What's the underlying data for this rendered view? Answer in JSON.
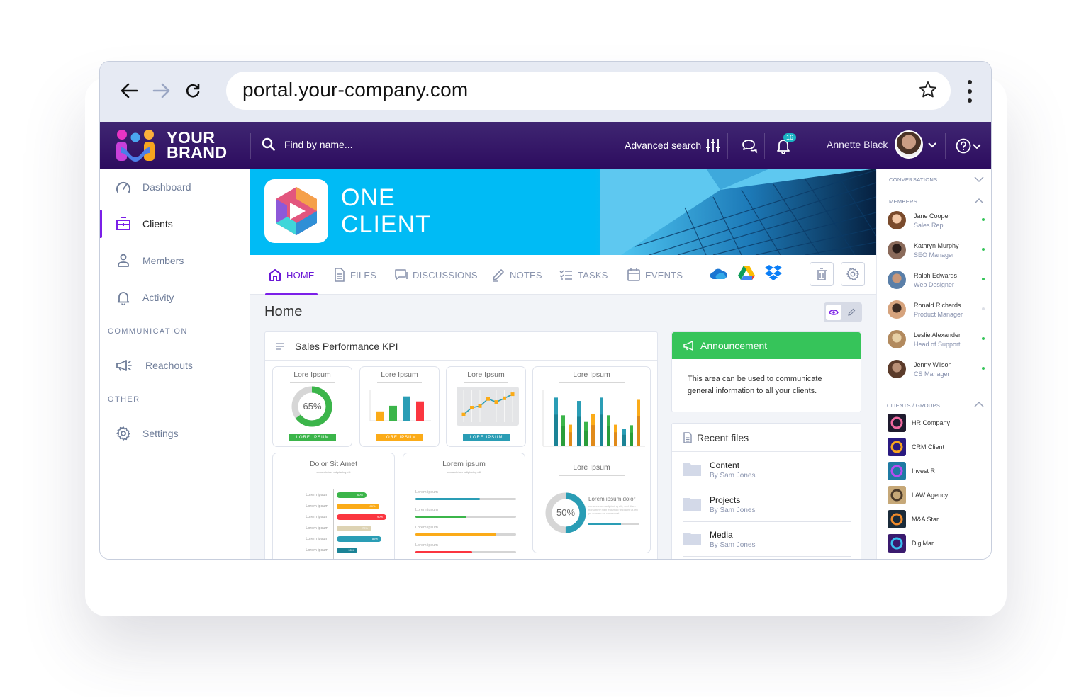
{
  "browser": {
    "url": "portal.your-company.com",
    "back_icon": "arrow-left-icon",
    "forward_icon": "arrow-right-icon",
    "reload_icon": "reload-icon",
    "bookmark_icon": "star-icon",
    "menu_icon": "kebab-menu-icon"
  },
  "header": {
    "brand_line1": "YOUR",
    "brand_line2": "BRAND",
    "search_placeholder": "Find by name...",
    "advanced_search": "Advanced search",
    "notifications_count": "16",
    "user_name": "Annette Black",
    "colors": {
      "header_top": "#3f2672",
      "header_bottom": "#2d0c5f",
      "badge": "#1ab4c3"
    }
  },
  "sidebar": {
    "items": [
      {
        "label": "Dashboard",
        "icon": "speedometer-icon"
      },
      {
        "label": "Clients",
        "icon": "briefcase-icon",
        "active": true
      },
      {
        "label": "Members",
        "icon": "user-icon"
      },
      {
        "label": "Activity",
        "icon": "bell-icon"
      }
    ],
    "section_communication": "COMMUNICATION",
    "communication_items": [
      {
        "label": "Reachouts",
        "icon": "megaphone-icon"
      }
    ],
    "section_other": "OTHER",
    "other_items": [
      {
        "label": "Settings",
        "icon": "gear-icon"
      }
    ],
    "accent": "#7b1fe8"
  },
  "banner": {
    "title_line1": "ONE",
    "title_line2": "CLIENT",
    "color": "#00bbf5"
  },
  "tabs": [
    {
      "label": "HOME",
      "icon": "home-icon",
      "active": true
    },
    {
      "label": "FILES",
      "icon": "document-icon"
    },
    {
      "label": "DISCUSSIONS",
      "icon": "chat-icon"
    },
    {
      "label": "NOTES",
      "icon": "pencil-icon"
    },
    {
      "label": "TASKS",
      "icon": "checklist-icon"
    },
    {
      "label": "EVENTS",
      "icon": "calendar-icon"
    }
  ],
  "integrations": [
    "onedrive-icon",
    "google-drive-icon",
    "dropbox-icon"
  ],
  "page": {
    "title": "Home"
  },
  "kpi": {
    "title": "Sales Performance KPI",
    "widgets": {
      "donut1": {
        "title": "Lore Ipsum",
        "percent": 65,
        "label": "65%",
        "tag": "LORE IPSUM",
        "color": "#3bb54a"
      },
      "bar1": {
        "title": "Lore Ipsum",
        "tag": "LORE IPSUM",
        "values": [
          30,
          48,
          78,
          62
        ],
        "colors": [
          "#fbab18",
          "#3bb54a",
          "#2a9db5",
          "#fb3640"
        ]
      },
      "line1": {
        "title": "Lore Ipsum",
        "tag": "LORE IPSUM",
        "values": [
          20,
          42,
          47,
          70,
          60,
          72,
          85
        ]
      },
      "grouped": {
        "title": "Lore Ipsum",
        "groups": [
          [
            88,
            56,
            39
          ],
          [
            82,
            44,
            59
          ],
          [
            88,
            56,
            39
          ],
          [
            32,
            38,
            84
          ]
        ]
      },
      "donut2": {
        "title": "Lore Ipsum",
        "percent": 50,
        "label": "50%",
        "heading": "Lorem ipsum dolor",
        "text": "consectetuer adipiscing elit, sed diam nonummy nibh euismod tincidunt ut, eu ps commo ex consequat",
        "progress": 65
      },
      "hbars": {
        "title": "Dolor Sit Amet",
        "subtitle": "consectetuer adipiscing elit",
        "rows": [
          {
            "label": "Lorem ipsum",
            "value": 60,
            "text": "60%",
            "color": "#3bb54a"
          },
          {
            "label": "Lorem ipsum",
            "value": 85,
            "text": "80%",
            "color": "#fbab18"
          },
          {
            "label": "Lorem ipsum",
            "value": 100,
            "text": "90%",
            "color": "#fb3640"
          },
          {
            "label": "Lorem ipsum",
            "value": 70,
            "text": "70%",
            "color": "#ddd3b4"
          },
          {
            "label": "Lorem ipsum",
            "value": 90,
            "text": "85%",
            "color": "#2a9db5"
          },
          {
            "label": "Lorem ipsum",
            "value": 42,
            "text": "90%",
            "color": "#1b8396"
          }
        ]
      },
      "progress": {
        "title": "Lorem ipsum",
        "subtitle": "consectetuer adipiscing elit",
        "rows": [
          {
            "label": "Lorem ipsum",
            "value": 64,
            "color": "#2a9db5"
          },
          {
            "label": "Lorem ipsum",
            "value": 51,
            "color": "#3bb54a"
          },
          {
            "label": "Lorem ipsum",
            "value": 80,
            "color": "#fbab18"
          },
          {
            "label": "Lorem ipsum",
            "value": 56,
            "color": "#fb3640"
          }
        ]
      }
    }
  },
  "announcement": {
    "title": "Announcement",
    "body": "This area can be used to communicate general information to all your clients.",
    "color": "#36c45a"
  },
  "recent_files": {
    "title": "Recent files",
    "items": [
      {
        "name": "Content",
        "by": "By Sam Jones"
      },
      {
        "name": "Projects",
        "by": "By Sam Jones"
      },
      {
        "name": "Media",
        "by": "By Sam Jones"
      }
    ]
  },
  "right_sidebar": {
    "conversations_label": "CONVERSATIONS",
    "members_label": "MEMBERS",
    "members": [
      {
        "name": "Jane Cooper",
        "role": "Sales Rep",
        "online": true
      },
      {
        "name": "Kathryn Murphy",
        "role": "SEO Manager",
        "online": true
      },
      {
        "name": "Ralph Edwards",
        "role": "Web Designer",
        "online": true
      },
      {
        "name": "Ronald Richards",
        "role": "Product Manager",
        "online": false
      },
      {
        "name": "Leslie Alexander",
        "role": "Head of Support",
        "online": true
      },
      {
        "name": "Jenny Wilson",
        "role": "CS Manager",
        "online": true
      }
    ],
    "clients_label": "CLIENTS / GROUPS",
    "clients": [
      {
        "name": "HR Company"
      },
      {
        "name": "CRM Client"
      },
      {
        "name": "Invest R"
      },
      {
        "name": "LAW Agency"
      },
      {
        "name": "M&A Star"
      },
      {
        "name": "DigiMar"
      }
    ]
  }
}
